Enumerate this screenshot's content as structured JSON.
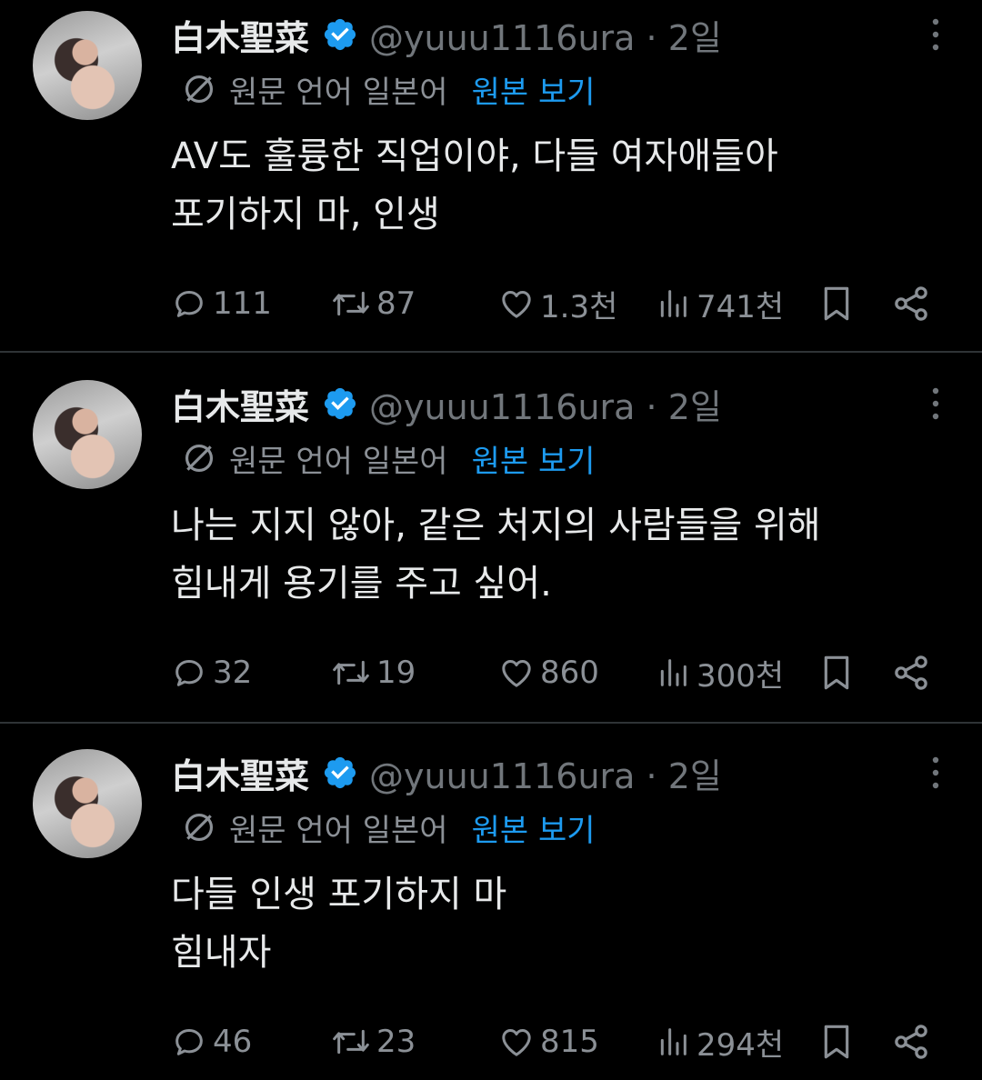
{
  "tweets": [
    {
      "name": "白木聖菜",
      "handle": "@yuuu1116ura",
      "time": "2일",
      "handle_time": "@yuuu1116ura · 2일",
      "translation_label": "원문 언어 일본어",
      "see_original": "원본 보기",
      "lines": [
        "AV도 훌륭한 직업이야, 다들 여자애들아",
        "포기하지 마, 인생"
      ],
      "replies": "111",
      "reposts": "87",
      "likes": "1.3천",
      "views": "741천"
    },
    {
      "name": "白木聖菜",
      "handle": "@yuuu1116ura",
      "time": "2일",
      "handle_time": "@yuuu1116ura · 2일",
      "translation_label": "원문 언어 일본어",
      "see_original": "원본 보기",
      "lines": [
        "나는 지지 않아, 같은 처지의 사람들을 위해",
        "힘내게 용기를 주고 싶어."
      ],
      "replies": "32",
      "reposts": "19",
      "likes": "860",
      "views": "300천"
    },
    {
      "name": "白木聖菜",
      "handle": "@yuuu1116ura",
      "time": "2일",
      "handle_time": "@yuuu1116ura · 2일",
      "translation_label": "원문 언어 일본어",
      "see_original": "원본 보기",
      "lines": [
        "다들 인생 포기하지 마",
        "힘내자"
      ],
      "replies": "46",
      "reposts": "23",
      "likes": "815",
      "views": "294천"
    }
  ],
  "colors": {
    "background": "#000000",
    "text": "#e7e9ea",
    "muted": "#71767b",
    "link": "#1d9bf0",
    "verified": "#1d9bf0",
    "divider": "#2f3336"
  },
  "icons": {
    "verified": "verified-badge-icon",
    "more": "more-dots-icon",
    "translate": "translate-globe-icon",
    "reply": "reply-bubble-icon",
    "repost": "repost-arrows-icon",
    "like": "heart-icon",
    "views": "views-bar-icon",
    "bookmark": "bookmark-icon",
    "share": "share-icon"
  }
}
